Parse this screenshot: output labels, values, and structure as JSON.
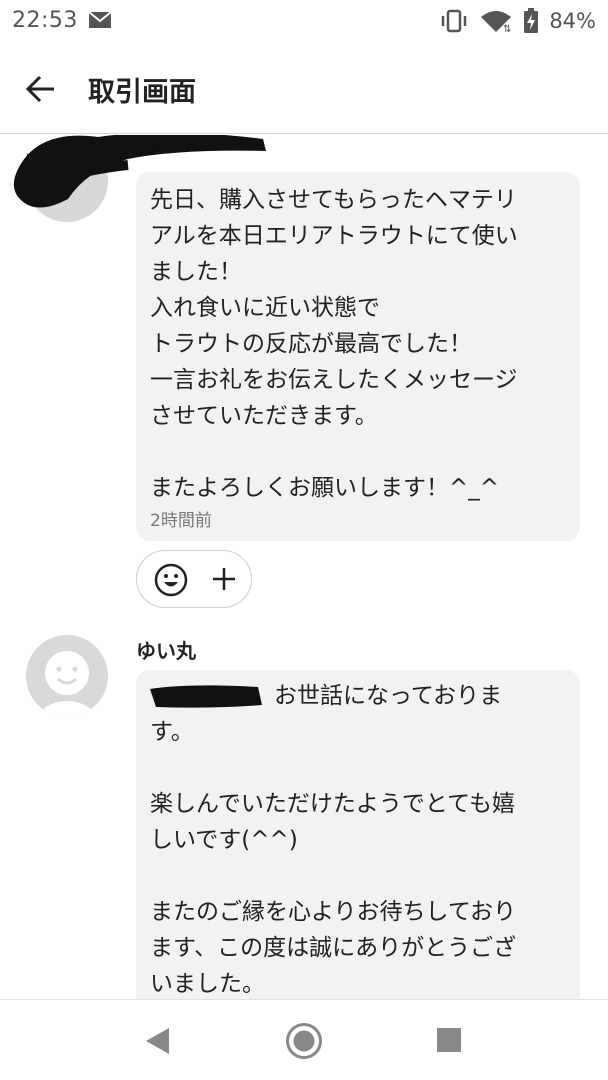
{
  "status_bar": {
    "time": "22:53",
    "battery_text": "84%",
    "icons": [
      "mail-icon",
      "vibrate-icon",
      "wifi-icon",
      "battery-charging-icon"
    ]
  },
  "header": {
    "title": "取引画面",
    "back_icon": "arrow-left-icon"
  },
  "messages": [
    {
      "sender": "",
      "avatar": "redacted",
      "lines": [
        "先日、購入させてもらったヘマテリ",
        "アルを本日エリアトラウトにて使い",
        "ました！",
        "入れ食いに近い状態で",
        "トラウトの反応が最高でした！",
        "一言お礼をお伝えしたくメッセージ",
        "させていただきます。",
        "",
        "またよろしくお願いします！^_^"
      ],
      "time": "2時間前"
    },
    {
      "sender": "ゆい丸",
      "avatar": "default-person",
      "first_line_suffix": "お世話になっておりま",
      "lines": [
        "す。",
        "",
        "楽しんでいただけたようでとても嬉",
        "しいです(^^)",
        "",
        "またのご縁を心よりお待ちしており",
        "ます、この度は誠にありがとうござ",
        "いました。"
      ]
    }
  ],
  "reactions": {
    "icons": [
      "smile-icon",
      "plus-icon"
    ]
  },
  "nav_bar": {
    "icons": [
      "nav-back-icon",
      "nav-home-icon",
      "nav-recent-icon"
    ]
  },
  "colors": {
    "bubble": "#f2f2f2",
    "text": "#222222",
    "muted": "#777777",
    "divider": "#d6d6d6"
  }
}
